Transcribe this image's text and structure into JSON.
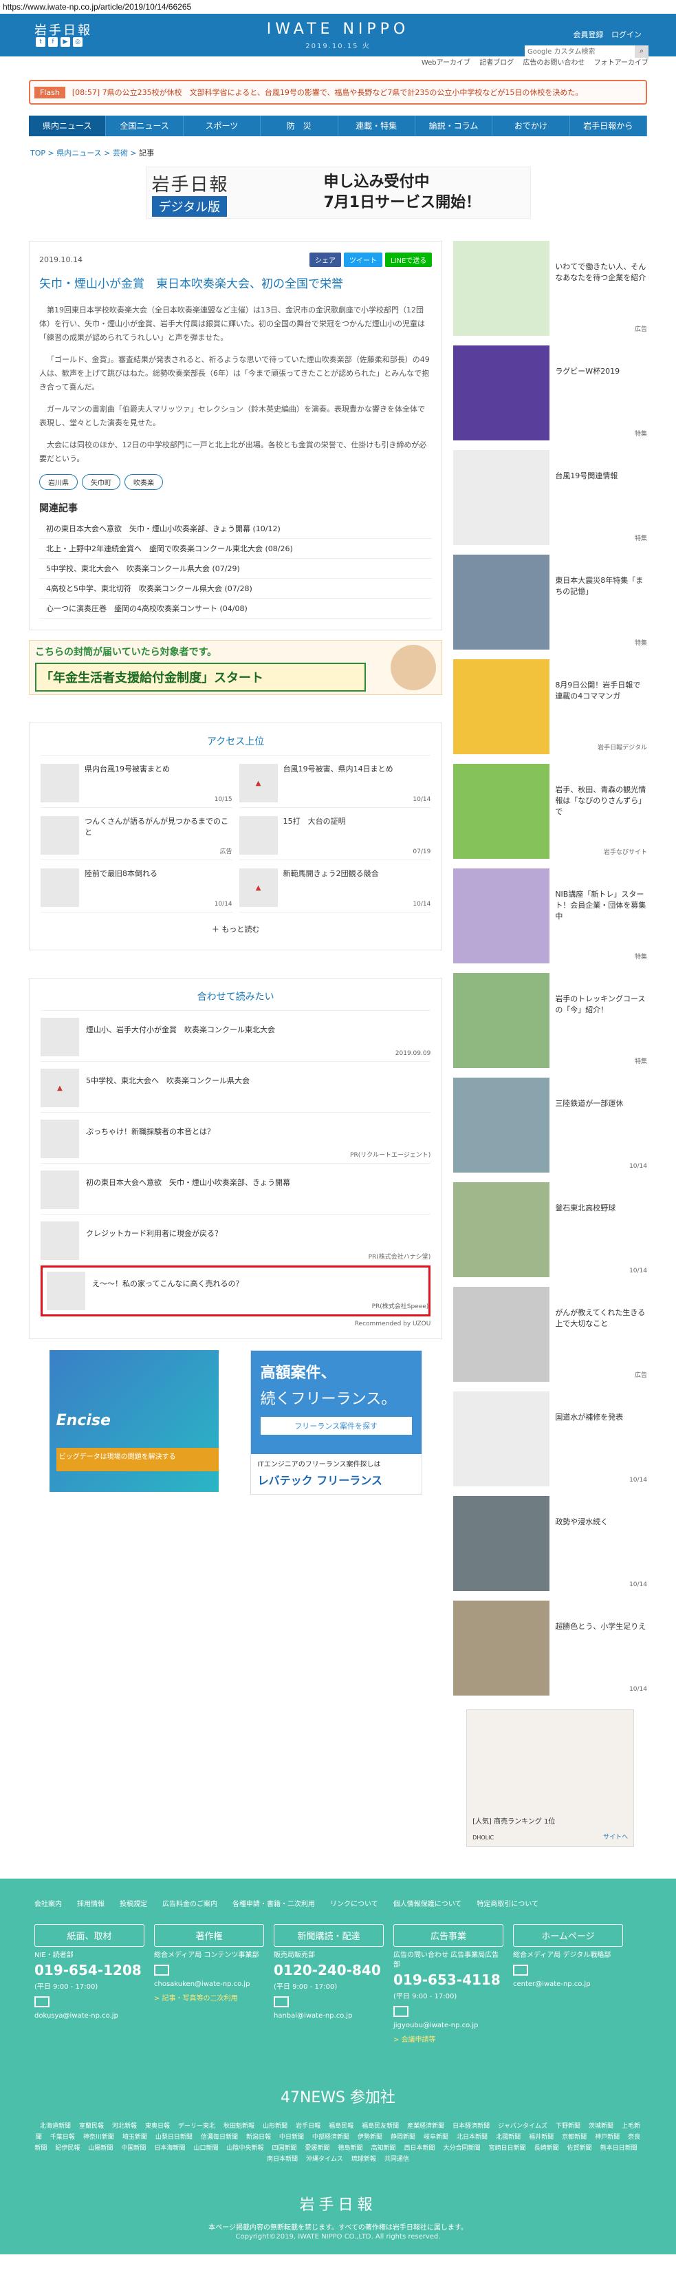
{
  "url": "https://www.iwate-np.co.jp/article/2019/10/14/66265",
  "header": {
    "logo": "岩手日報",
    "center_logo": "IWATE NIPPO",
    "date": "2019.10.15 火",
    "register": "会員登録",
    "login": "ログイン",
    "search_placeholder": "Google カスタム検索",
    "sub_links": [
      "Webアーカイブ",
      "記者ブログ",
      "広告のお問い合わせ",
      "フォトアーカイブ"
    ]
  },
  "flash": {
    "tag": "Flash",
    "text": "[08:57] 7県の公立235校が休校　文部科学省によると、台風19号の影響で、福島や長野など7県で計235の公立小中学校などが15日の休校を決めた。"
  },
  "nav": [
    "県内ニュース",
    "全国ニュース",
    "スポーツ",
    "防　災",
    "連載・特集",
    "論説・コラム",
    "おでかけ",
    "岩手日報から"
  ],
  "breadcrumb": [
    "TOP",
    "県内ニュース",
    "芸術",
    "記事"
  ],
  "banner": {
    "title": "岩手日報",
    "sub": "デジタル版",
    "right1": "申し込み受付中",
    "right2": "7月1日サービス開始！"
  },
  "article": {
    "date": "2019.10.14",
    "share": [
      "シェア",
      "ツイート",
      "LINEで送る"
    ],
    "title": "矢巾・煙山小が金賞　東日本吹奏楽大会、初の全国で栄誉",
    "body": [
      "第19回東日本学校吹奏楽大会（全日本吹奏楽連盟など主催）は13日、金沢市の金沢歌劇座で小学校部門（12団体）を行い、矢巾・煙山小が金賞、岩手大付属は銀賞に輝いた。初の全国の舞台で栄冠をつかんだ煙山小の児童は「練習の成果が認められてうれしい」と声を弾ませた。",
      "「ゴールド、金賞」。審査結果が発表されると、祈るような思いで待っていた煙山吹奏楽部（佐藤柔和部長）の49人は、歓声を上げて跳びはねた。総勢吹奏楽部長（6年）は「今まで頑張ってきたことが認められた」とみんなで抱き合って喜んだ。",
      "ガールマンの書割曲「伯爵夫人マリッツァ」セレクション（鈴木英史編曲）を演奏。表現豊かな響きを体全体で表現し、堂々とした演奏を見せた。",
      "大会には同校のほか、12日の中学校部門に一戸と北上北が出場。各校とも金賞の栄誉で、仕掛けも引き締めが必要だという。"
    ],
    "tags": [
      "岩川県",
      "矢巾町",
      "吹奏楽"
    ],
    "related_heading": "関連記事",
    "related": [
      "初の東日本大会へ意欲　矢巾・煙山小吹奏楽部、きょう開幕 (10/12)",
      "北上・上野中2年連続金賞へ　盛岡で吹奏楽コンクール東北大会 (08/26)",
      "5中学校、東北大会へ　吹奏楽コンクール県大会 (07/29)",
      "4高校と5中学、東北切符　吹奏楽コンクール県大会 (07/28)",
      "心一つに演奏圧巻　盛岡の4高校吹奏楽コンサート (04/08)"
    ]
  },
  "ad_pension": {
    "line1": "こちらの封筒が届いていたら対象者です。",
    "line2": "「年金生活者支援給付金制度」スタート"
  },
  "access": {
    "title": "アクセス上位",
    "items": [
      {
        "text": "県内台風19号被害まとめ",
        "date": "10/15"
      },
      {
        "text": "台風19号被害、県内14日まとめ",
        "date": "10/14"
      },
      {
        "text": "つんくさんが語るがんが見つかるまでのこと",
        "date": "広告"
      },
      {
        "text": "15打　大台の証明",
        "date": "07/19"
      },
      {
        "text": "陸前で最旧8本倒れる",
        "date": "10/14"
      },
      {
        "text": "新範馬開きょう2団観る競合",
        "date": "10/14"
      }
    ],
    "more": "もっと読む"
  },
  "recommend": {
    "title": "合わせて読みたい",
    "items": [
      {
        "text": "煙山小、岩手大付小が金賞　吹奏楽コンクール東北大会",
        "date": "2019.09.09"
      },
      {
        "text": "5中学校、東北大会へ　吹奏楽コンクール県大会",
        "date": ""
      },
      {
        "text": "ぷっちゃけ！新職採験者の本音とは？",
        "date": "PR(リクルートエージェント)"
      },
      {
        "text": "初の東日本大会へ意欲　矢巾・煙山小吹奏楽部、きょう開幕",
        "date": ""
      },
      {
        "text": "クレジットカード利用者に現金が戻る？",
        "date": "PR(株式会社ハナシ堂)"
      },
      {
        "text": "え〜〜！私の家ってこんなに高く売れるの？",
        "date": "PR(株式会社Speee)"
      }
    ],
    "footer": "Recommended by UZOU"
  },
  "ads_bottom": {
    "enc_title": "Encise",
    "enc_text": "ビッグデータは現場の問題を解決する",
    "free1": "高額案件、",
    "free2": "続くフリーランス。",
    "free_btn": "フリーランス案件を探す",
    "free_sub": "ITエンジニアのフリーランス案件探しは",
    "free_brand": "レバテック フリーランス"
  },
  "sidebar": [
    {
      "text": "いわてで働きたい人、そんなあなたを待つ企業を紹介",
      "date": "広告"
    },
    {
      "text": "ラグビーW杯2019",
      "date": "特集"
    },
    {
      "text": "台風19号関連情報",
      "date": "特集"
    },
    {
      "text": "東日本大震災8年特集「まちの記憶」",
      "date": "特集"
    },
    {
      "text": "8月9日公開！岩手日報で連載の4コママンガ",
      "date": "岩手日報デジタル"
    },
    {
      "text": "岩手、秋田、青森の観光情報は「なびのりさんずら」で",
      "date": "岩手なびサイト"
    },
    {
      "text": "NIB講座「新トレ」スタート！会員企業・団体を募集中",
      "date": "特集"
    },
    {
      "text": "岩手のトレッキングコースの「今」紹介！",
      "date": "特集"
    },
    {
      "text": "三陸鉄道が一部運休",
      "date": "10/14"
    },
    {
      "text": "釜石東北高校野球",
      "date": "10/14"
    },
    {
      "text": "がんが教えてくれた生きる上で大切なこと",
      "date": "広告"
    },
    {
      "text": "国道水が補修を発表",
      "date": "10/14"
    },
    {
      "text": "政勢や浸水続く",
      "date": "10/14"
    },
    {
      "text": "超勝色とう、小学生足りえ",
      "date": "10/14"
    }
  ],
  "side_ad": {
    "label": "[人気] 商売ランキング 1位",
    "brand": "DHOLIC",
    "more": "サイトへ"
  },
  "footer": {
    "links": [
      "会社案内",
      "採用情報",
      "投稿規定",
      "広告料金のご案内",
      "各種申請・書籍・二次利用",
      "リンクについて",
      "個人情報保護について",
      "特定商取引について"
    ],
    "cols": [
      {
        "head": "紙面、取材",
        "small": "NIE・読者部",
        "tel": "019-654-1208",
        "hours": "(平日 9:00 - 17:00)",
        "mail": "dokusya@iwate-np.co.jp",
        "link": ""
      },
      {
        "head": "著作権",
        "small": "総合メディア局 コンテンツ事業部",
        "tel": "",
        "hours": "",
        "mail": "chosakuken@iwate-np.co.jp",
        "link": "> 記事・写真等の二次利用"
      },
      {
        "head": "新聞購読・配達",
        "small": "販売局販売部",
        "tel": "0120-240-840",
        "hours": "(平日 9:00 - 17:00)",
        "mail": "hanbai@iwate-np.co.jp",
        "link": ""
      },
      {
        "head": "広告事業",
        "small": "広告の問い合わせ 広告事業局広告部",
        "tel": "019-653-4118",
        "hours": "(平日 9:00 - 17:00)",
        "mail": "jigyoubu@iwate-np.co.jp",
        "link": "> 会議申請等"
      },
      {
        "head": "ホームページ",
        "small": "総合メディア局 デジタル戦略部",
        "tel": "",
        "hours": "",
        "mail": "center@iwate-np.co.jp",
        "link": ""
      }
    ],
    "n47_title": "47NEWS 参加社",
    "n47": [
      "北海道新聞",
      "室蘭民報",
      "河北新報",
      "東奥日報",
      "デーリー東北",
      "秋田魁新報",
      "山形新聞",
      "岩手日報",
      "福島民報",
      "福島民友新聞",
      "産業経済新聞",
      "日本経済新聞",
      "ジャパンタイムズ",
      "下野新聞",
      "茨城新聞",
      "上毛新聞",
      "千葉日報",
      "神奈川新聞",
      "埼玉新聞",
      "山梨日日新聞",
      "信濃毎日新聞",
      "新潟日報",
      "中日新聞",
      "中部経済新聞",
      "伊勢新聞",
      "静岡新聞",
      "岐阜新聞",
      "北日本新聞",
      "北國新聞",
      "福井新聞",
      "京都新聞",
      "神戸新聞",
      "奈良新聞",
      "紀伊民報",
      "山陽新聞",
      "中国新聞",
      "日本海新聞",
      "山口新聞",
      "山陰中央新報",
      "四国新聞",
      "愛媛新聞",
      "徳島新聞",
      "高知新聞",
      "西日本新聞",
      "大分合同新聞",
      "宮崎日日新聞",
      "長崎新聞",
      "佐賀新聞",
      "熊本日日新聞",
      "南日本新聞",
      "沖縄タイムス",
      "琉球新報",
      "共同通信"
    ],
    "logo": "岩手日報",
    "note": "本ページ掲載内容の無断転載を禁じます。すべての著作権は岩手日報社に属します。",
    "copy": "Copyright©2019, IWATE NIPPO CO.,LTD. All rights reserved."
  }
}
